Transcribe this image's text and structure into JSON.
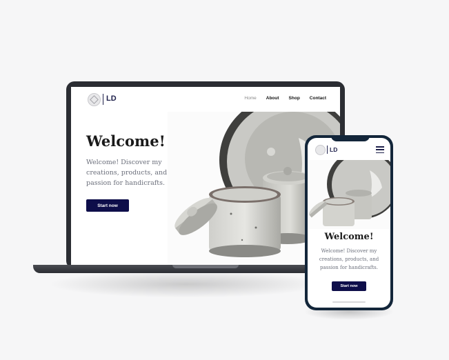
{
  "brand": {
    "initials": "LD",
    "logo_icon": "seal-logo-icon"
  },
  "nav": {
    "items": [
      {
        "label": "Home",
        "active": true
      },
      {
        "label": "About",
        "active": false
      },
      {
        "label": "Shop",
        "active": false
      },
      {
        "label": "Contact",
        "active": false
      }
    ]
  },
  "hero": {
    "title": "Welcome!",
    "text_lines": [
      "Welcome! Discover my",
      "creations, products, and",
      "passion for handicrafts."
    ],
    "button_label": "Start now"
  },
  "colors": {
    "accent": "#0e0e4a",
    "brand": "#1d1f4a",
    "device_frame": "#2b2d33",
    "phone_frame": "#13263a"
  },
  "mobile": {
    "menu_icon": "hamburger-menu-icon"
  }
}
